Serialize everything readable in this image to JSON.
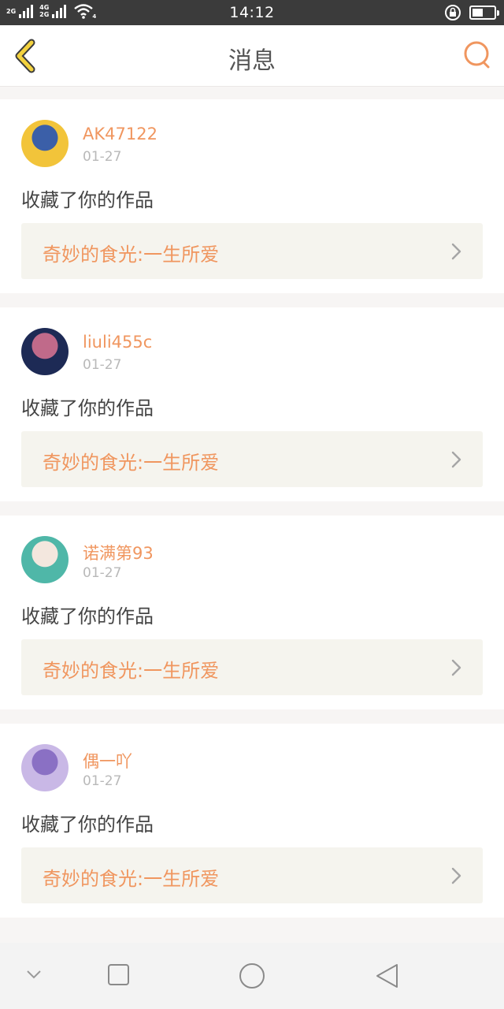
{
  "status_bar": {
    "network_1": "2G",
    "network_2_top": "4G",
    "network_2_bottom": "2G",
    "wifi_badge": "4",
    "time": "14:12",
    "battery_level": 0.5,
    "icons": [
      "signal-icon",
      "wifi-icon",
      "rotation-lock-icon",
      "battery-icon"
    ]
  },
  "header": {
    "title": "消息",
    "back_icon": "chevron-left-icon",
    "search_icon": "search-icon",
    "accent_color": "#f0965f"
  },
  "messages": [
    {
      "username": "AK47122",
      "date": "01-27",
      "action": "收藏了你的作品",
      "work_title": "奇妙的食光:一生所爱",
      "avatar_colors": [
        "#f2c43a",
        "#3b5fa8"
      ]
    },
    {
      "username": "liuli455c",
      "date": "01-27",
      "action": "收藏了你的作品",
      "work_title": "奇妙的食光:一生所爱",
      "avatar_colors": [
        "#1d2a55",
        "#c06a8a"
      ]
    },
    {
      "username": "诺满第93",
      "date": "01-27",
      "action": "收藏了你的作品",
      "work_title": "奇妙的食光:一生所爱",
      "avatar_colors": [
        "#4fb7a8",
        "#f3e7de"
      ]
    },
    {
      "username": "偶一吖",
      "date": "01-27",
      "action": "收藏了你的作品",
      "work_title": "奇妙的食光:一生所爱",
      "avatar_colors": [
        "#c9b8e6",
        "#8a70c4"
      ]
    }
  ],
  "nav_bar": {
    "icons": [
      "collapse-icon",
      "recents-icon",
      "home-icon",
      "back-triangle-icon"
    ]
  }
}
